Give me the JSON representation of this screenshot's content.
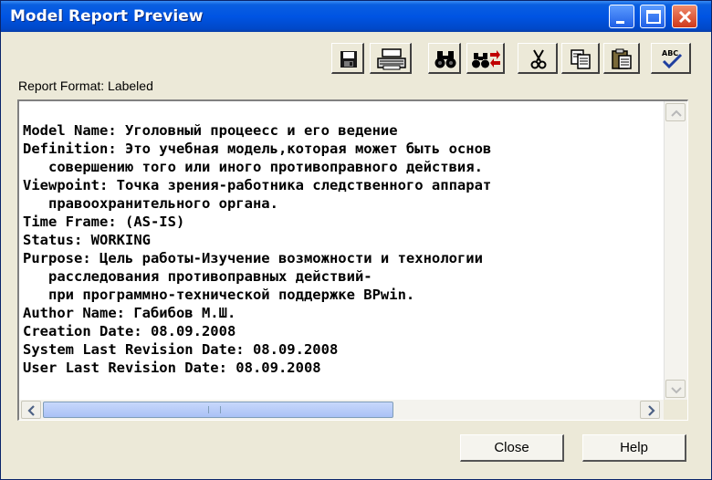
{
  "window": {
    "title": "Model Report Preview"
  },
  "toolbar": {
    "groups": [
      [
        "save-icon",
        "print-icon"
      ],
      [
        "find-icon",
        "find-next-icon"
      ],
      [
        "cut-icon",
        "copy-icon",
        "paste-icon"
      ],
      [
        "spell-check-icon"
      ]
    ],
    "spell_label": "ABC"
  },
  "report": {
    "format_label": "Report Format: Labeled",
    "lines": [
      "Model Name: Уголовный процеесс и его ведение",
      "Definition: Это учебная модель,которая может быть основ",
      "   совершению того или иного противоправного действия.",
      "Viewpoint: Точка зрения-работника следственного аппарат",
      "   правоохранительного органа.",
      "Time Frame: (AS-IS)",
      "Status: WORKING",
      "Purpose: Цель работы-Изучение возможности и технологии",
      "   расследования противоправных действий-",
      "   при программно-технической поддержке BPwin.",
      "Author Name: Габибов М.Ш.",
      "Creation Date: 08.09.2008",
      "System Last Revision Date: 08.09.2008",
      "User Last Revision Date: 08.09.2008"
    ]
  },
  "buttons": {
    "close": "Close",
    "help": "Help"
  },
  "colors": {
    "titlebar": "#0054e3",
    "window_bg": "#ece9d8",
    "close_button": "#d0391a"
  }
}
